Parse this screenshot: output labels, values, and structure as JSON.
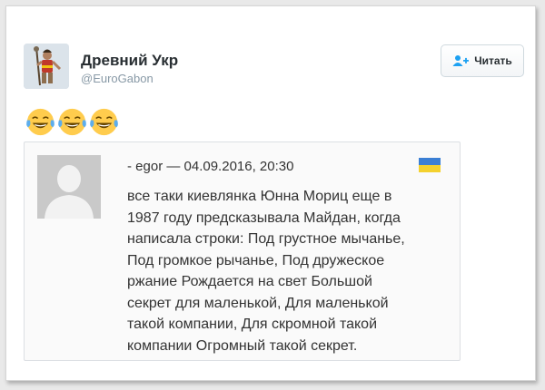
{
  "tweet": {
    "author_name": "Древний Укр",
    "author_handle": "@EuroGabon",
    "follow_label": "Читать",
    "emojis": [
      "face-with-tears-of-joy-icon",
      "face-with-tears-of-joy-icon",
      "face-with-tears-of-joy-icon"
    ]
  },
  "quote": {
    "meta": "- egor — 04.09.2016, 20:30",
    "lines": [
      "все таки киевлянка Юнна Мориц еще в",
      "1987 году предсказывала Майдан, когда",
      "написала строки: Под грустное мычанье,",
      "Под громкое рычанье, Под дружеское",
      "ржание Рождается на свет Большой",
      "секрет для маленькой, Для маленькой",
      "такой компании, Для скромной такой",
      "компании Огромный такой секрет."
    ]
  },
  "colors": {
    "flag_top": "#3b7fd4",
    "flag_bottom": "#f4d12e",
    "follow_icon": "#1da1f2"
  }
}
